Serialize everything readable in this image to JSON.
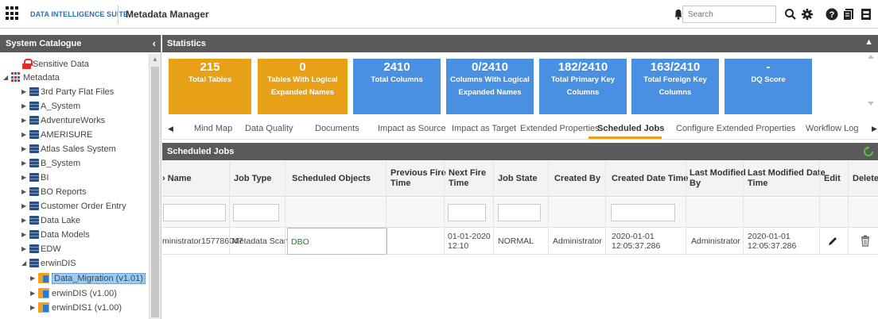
{
  "topbar": {
    "suite_name": "DATA INTELLIGENCE SUITE",
    "app_title": "Metadata Manager",
    "search_placeholder": "Search"
  },
  "sidebar": {
    "title": "System Catalogue",
    "collapse_glyph": "‹",
    "items": [
      {
        "label": "Sensitive Data",
        "icon": "lock-icon"
      },
      {
        "label": "Metadata",
        "icon": "metadata-icon"
      },
      {
        "label": "3rd Party Flat Files",
        "icon": "database-icon"
      },
      {
        "label": "A_System",
        "icon": "database-icon"
      },
      {
        "label": "AdventureWorks",
        "icon": "database-icon"
      },
      {
        "label": "AMERISURE",
        "icon": "database-icon"
      },
      {
        "label": "Atlas Sales System",
        "icon": "database-icon"
      },
      {
        "label": "B_System",
        "icon": "database-icon"
      },
      {
        "label": "BI",
        "icon": "database-icon"
      },
      {
        "label": "BO Reports",
        "icon": "database-icon"
      },
      {
        "label": "Customer Order Entry",
        "icon": "database-icon"
      },
      {
        "label": "Data Lake",
        "icon": "database-icon"
      },
      {
        "label": "Data Models",
        "icon": "database-icon"
      },
      {
        "label": "EDW",
        "icon": "database-icon"
      },
      {
        "label": "erwinDIS",
        "icon": "database-icon"
      },
      {
        "label": "Data_Migration (v1.01)",
        "icon": "model-icon"
      },
      {
        "label": "erwinDIS (v1.00)",
        "icon": "model-icon"
      },
      {
        "label": "erwinDIS1 (v1.00)",
        "icon": "model-icon"
      }
    ]
  },
  "statistics": {
    "title": "Statistics",
    "tiles": [
      {
        "value": "215",
        "label_lines": [
          "Total Tables"
        ]
      },
      {
        "value": "0",
        "label_lines": [
          "Tables With Logical",
          "Expanded Names"
        ]
      },
      {
        "value": "2410",
        "label_lines": [
          "Total Columns"
        ]
      },
      {
        "value": "0/2410",
        "label_lines": [
          "Columns With Logical",
          "Expanded Names"
        ]
      },
      {
        "value": "182/2410",
        "label_lines": [
          "Total Primary Key",
          "Columns"
        ]
      },
      {
        "value": "163/2410",
        "label_lines": [
          "Total Foreign Key",
          "Columns"
        ]
      },
      {
        "value": "-",
        "label_lines": [
          "DQ Score"
        ]
      }
    ]
  },
  "tabs": {
    "items": [
      "Mind Map",
      "Data Quality",
      "Documents",
      "Impact as Source",
      "Impact as Target",
      "Extended Properties",
      "Scheduled Jobs",
      "Configure Extended Properties",
      "Workflow Log"
    ],
    "active": "Scheduled Jobs"
  },
  "scheduled_jobs": {
    "title": "Scheduled Jobs",
    "columns": [
      "› Name",
      "Job Type",
      "Scheduled Objects",
      "Previous Fire Time",
      "Next Fire Time",
      "Job State",
      "Created By",
      "Created Date Time",
      "Last Modified By",
      "Last Modified Date Time",
      "Edit",
      "Delete"
    ],
    "header_display": {
      "name": "› Name",
      "job_type": "Job Type",
      "scheduled_objects": "Scheduled Objects",
      "prev_fire_1": "Previous Fire",
      "prev_fire_2": "Time",
      "next_fire_1": "Next Fire",
      "next_fire_2": "Time",
      "job_state": "Job State",
      "created_by": "Created By",
      "created_dt": "Created Date Time",
      "last_mod_by_1": "Last Modified",
      "last_mod_by_2": "By",
      "last_mod_dt_1": "Last Modified Date",
      "last_mod_dt_2": "Time",
      "edit": "Edit",
      "delete": "Delete"
    },
    "rows": [
      {
        "name": "ministrator157786047",
        "job_type": "Metadata Scan",
        "scheduled_objects": "DBO",
        "previous_fire_time": "",
        "next_fire_date": "01-01-2020",
        "next_fire_time": "12:10",
        "job_state": "NORMAL",
        "created_by": "Administrator",
        "created_date": "2020-01-01",
        "created_time": "12:05:37.286",
        "last_modified_by": "Administrator",
        "last_modified_date": "2020-01-01",
        "last_modified_time": "12:05:37.286"
      }
    ]
  },
  "colors": {
    "header_bg": "#5a5a5a",
    "tile_orange": "#e8a116",
    "tile_blue": "#4a90e2",
    "active_tab_underline": "#e8a116",
    "scheduled_object_text": "#2e7d32"
  }
}
